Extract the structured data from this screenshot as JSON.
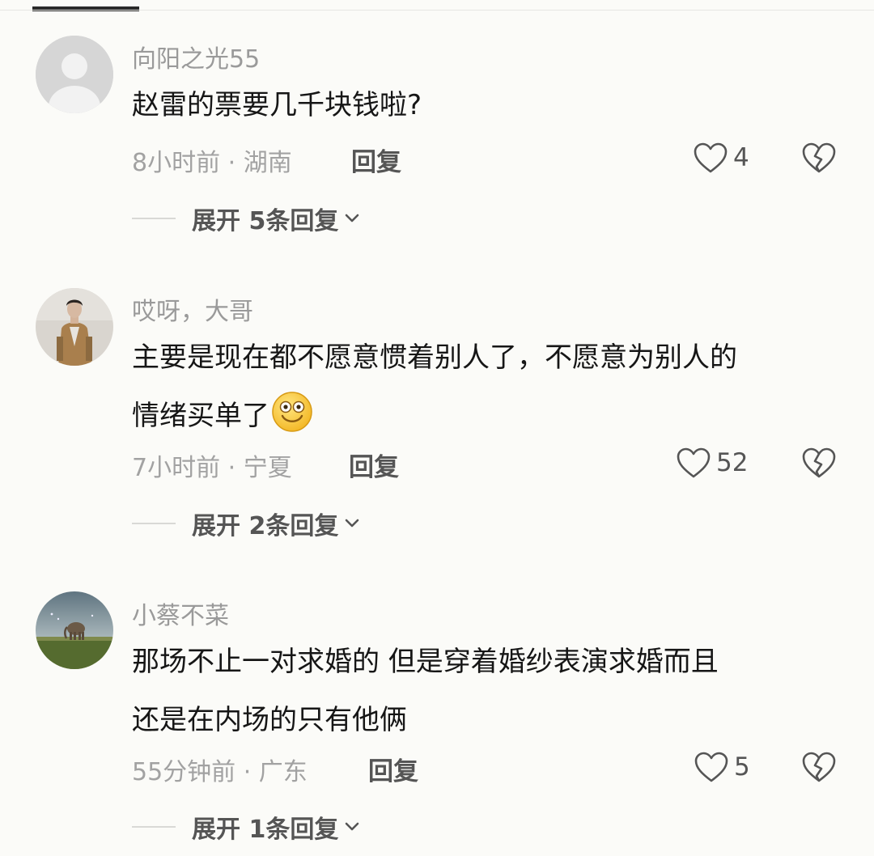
{
  "comments": [
    {
      "username": "向阳之光55",
      "avatar": "default-avatar-icon",
      "text": "赵雷的票要几千块钱啦?",
      "time_location": "8小时前 · 湖南",
      "reply_label": "回复",
      "likes": "4",
      "expand_label": "展开 5条回复"
    },
    {
      "username": "哎呀，大哥",
      "avatar": "user-photo-man-in-coat",
      "text_line1": "主要是现在都不愿意惯着别人了，不愿意为别人的",
      "text_line2": "情绪买单了",
      "emoji": "grinning-face-emoji",
      "time_location": "7小时前 · 宁夏",
      "reply_label": "回复",
      "likes": "52",
      "expand_label": "展开 2条回复"
    },
    {
      "username": "小蔡不菜",
      "avatar": "user-photo-elephant-landscape",
      "text_line1": "那场不止一对求婚的 但是穿着婚纱表演求婚而且",
      "text_line2": "还是在内场的只有他俩",
      "time_location": "55分钟前 · 广东",
      "reply_label": "回复",
      "likes": "5",
      "expand_label": "展开 1条回复"
    }
  ],
  "icons": {
    "like": "heart-outline-icon",
    "dislike": "broken-heart-icon",
    "expand": "chevron-down-icon"
  },
  "colors": {
    "background": "#fbfbf8",
    "username": "#9a9a9a",
    "text": "#161616",
    "meta": "#a2a2a2",
    "action": "#555555"
  }
}
